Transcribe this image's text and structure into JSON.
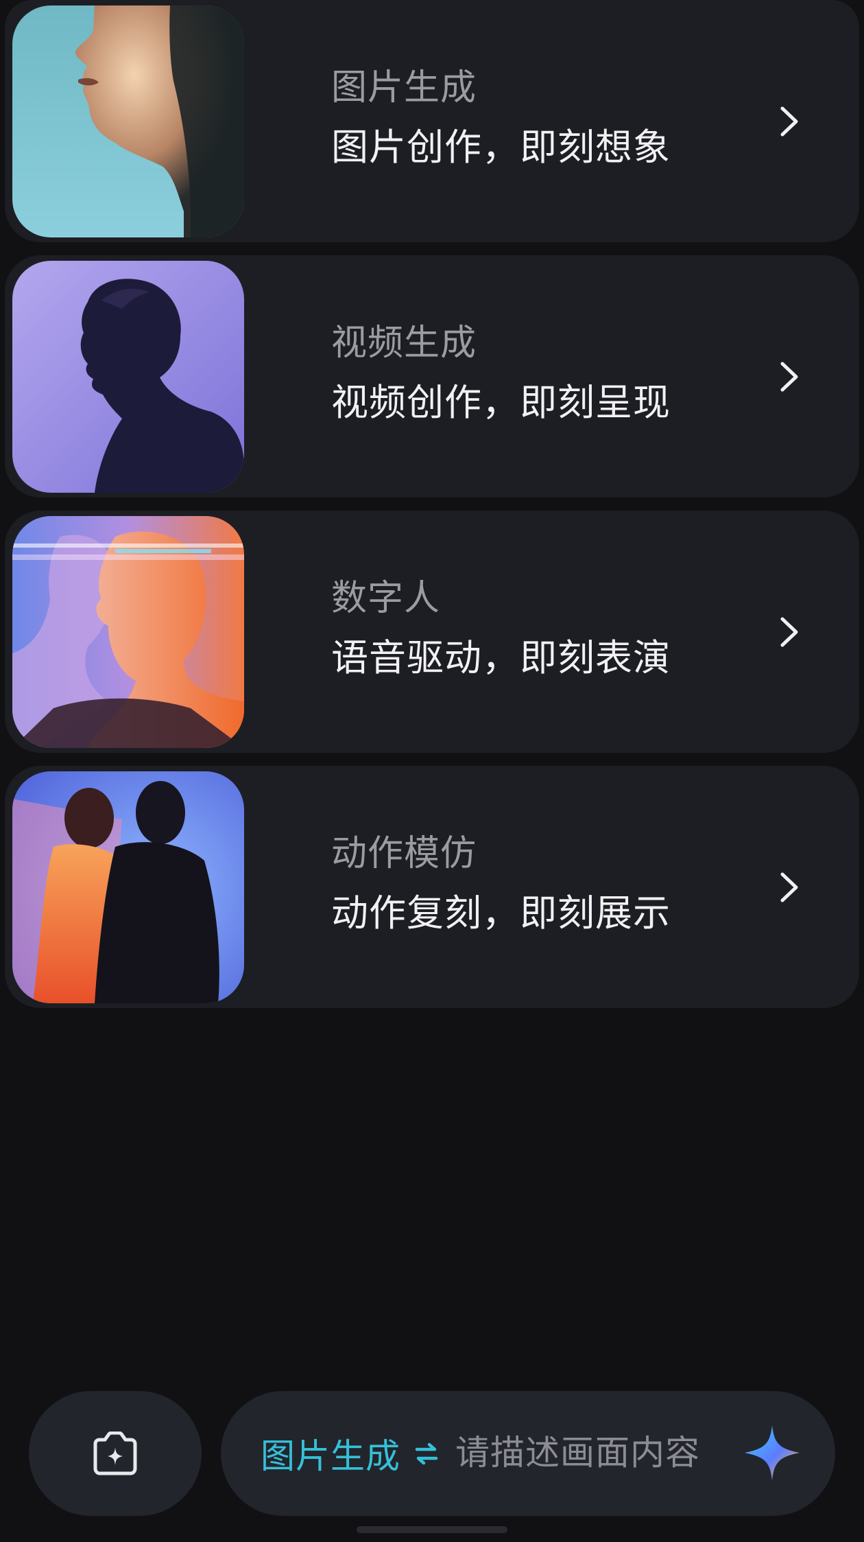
{
  "features": [
    {
      "id": "image",
      "title": "图片生成",
      "subtitle": "图片创作，即刻想象",
      "thumb_icon": "profile-portrait-image"
    },
    {
      "id": "video",
      "title": "视频生成",
      "subtitle": "视频创作，即刻呈现",
      "thumb_icon": "silhouette-portrait-image"
    },
    {
      "id": "avatar",
      "title": "数字人",
      "subtitle": "语音驱动，即刻表演",
      "thumb_icon": "double-exposure-portrait-image"
    },
    {
      "id": "motion",
      "title": "动作模仿",
      "subtitle": "动作复刻，即刻展示",
      "thumb_icon": "motion-blur-figures-image"
    }
  ],
  "bottom_bar": {
    "camera_icon": "camera-sparkle-icon",
    "mode_label": "图片生成",
    "swap_icon": "swap-arrows-icon",
    "prompt_placeholder": "请描述画面内容",
    "send_icon": "sparkle-icon"
  },
  "colors": {
    "background": "#111114",
    "card": "#1d1e23",
    "accent": "#35c0d9",
    "title": "#9b9ca3",
    "subtitle": "#f1f1f3"
  }
}
